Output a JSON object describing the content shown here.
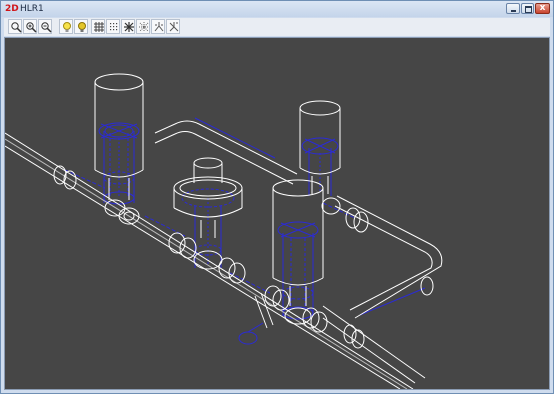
{
  "window": {
    "app_badge": "2D",
    "title": "HLR1",
    "controls": {
      "minimize": "minimize",
      "maximize": "maximize",
      "close": "close",
      "close_glyph": "x"
    }
  },
  "toolbar": {
    "buttons": [
      {
        "name": "zoom-window-icon"
      },
      {
        "name": "zoom-in-icon"
      },
      {
        "name": "zoom-out-icon"
      },
      {
        "name": "light-bulb-icon"
      },
      {
        "name": "light-bulb-shaded-icon"
      },
      {
        "name": "grid-icon"
      },
      {
        "name": "dot-grid-icon"
      },
      {
        "name": "axes-icon"
      },
      {
        "name": "axes-dotted-icon"
      },
      {
        "name": "hidden-line-icon"
      },
      {
        "name": "perspective-icon"
      }
    ]
  },
  "viewport": {
    "background": "#464646",
    "visible_line_color": "#ffffff",
    "hidden_line_color": "#2b2bd6"
  }
}
